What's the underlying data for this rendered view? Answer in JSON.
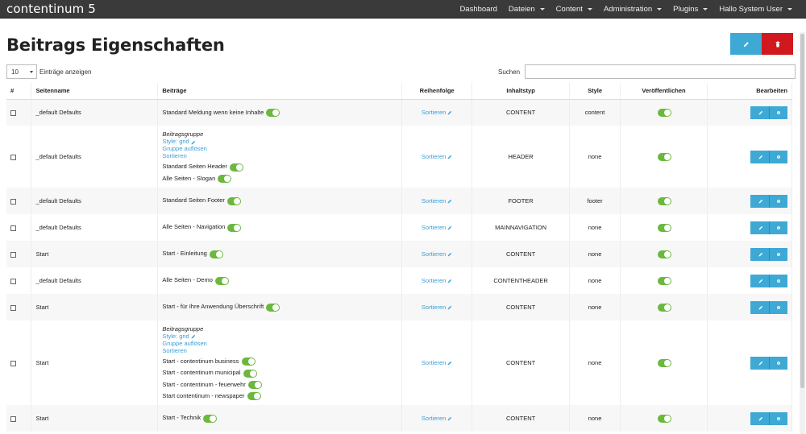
{
  "app": {
    "brand": "contentinum 5"
  },
  "nav": [
    {
      "label": "Dashboard",
      "caret": false
    },
    {
      "label": "Dateien",
      "caret": true
    },
    {
      "label": "Content",
      "caret": true
    },
    {
      "label": "Administration",
      "caret": true
    },
    {
      "label": "Plugins",
      "caret": true
    },
    {
      "label": "Hallo System User",
      "caret": true
    }
  ],
  "page": {
    "title": "Beitrags Eigenschaften"
  },
  "controls": {
    "length_value": "10",
    "length_label": "Einträge anzeigen",
    "search_label": "Suchen",
    "search_value": ""
  },
  "colors": {
    "accent": "#3ea9d5",
    "danger": "#d0181e",
    "toggle": "#6bb83e",
    "link": "#3a9ed4"
  },
  "table": {
    "headers": [
      "#",
      "Seitenname",
      "Beiträge",
      "Reihenfolge",
      "Inhaltstyp",
      "Style",
      "Veröffentlichen",
      "Bearbeiten"
    ],
    "rows": [
      {
        "name": "_default Defaults",
        "group": null,
        "items": [
          "Standard Meldung wenn keine Inhalte"
        ],
        "order": "Sortieren",
        "type": "CONTENT",
        "style": "content",
        "published": true
      },
      {
        "name": "_default Defaults",
        "group": {
          "title": "Beitragsgruppe",
          "style": "Style: grid",
          "dissolve": "Gruppe auflösen",
          "sort": "Sortieren"
        },
        "items": [
          "Standard Seiten Header",
          "Alle Seiten - Slogan"
        ],
        "order": "Sortieren",
        "type": "HEADER",
        "style": "none",
        "published": true
      },
      {
        "name": "_default Defaults",
        "group": null,
        "items": [
          "Standard Seiten Footer"
        ],
        "order": "Sortieren",
        "type": "FOOTER",
        "style": "footer",
        "published": true
      },
      {
        "name": "_default Defaults",
        "group": null,
        "items": [
          "Alle Seiten - Navigation"
        ],
        "order": "Sortieren",
        "type": "MAINNAVIGATION",
        "style": "none",
        "published": true
      },
      {
        "name": "Start",
        "group": null,
        "items": [
          "Start - Einleitung"
        ],
        "order": "Sortieren",
        "type": "CONTENT",
        "style": "none",
        "published": true
      },
      {
        "name": "_default Defaults",
        "group": null,
        "items": [
          "Alle Seiten - Demo"
        ],
        "order": "Sortieren",
        "type": "CONTENTHEADER",
        "style": "none",
        "published": true
      },
      {
        "name": "Start",
        "group": null,
        "items": [
          "Start - für Ihre Anwendung Überschrift"
        ],
        "order": "Sortieren",
        "type": "CONTENT",
        "style": "none",
        "published": true
      },
      {
        "name": "Start",
        "group": {
          "title": "Beitragsgruppe",
          "style": "Style: grid",
          "dissolve": "Gruppe auflösen",
          "sort": "Sortieren"
        },
        "items": [
          "Start - contentinum business",
          "Start - contentinum municipal",
          "Start - contentinum - feuerwehr",
          "Start contentinum - newspaper"
        ],
        "order": "Sortieren",
        "type": "CONTENT",
        "style": "none",
        "published": true
      },
      {
        "name": "Start",
        "group": null,
        "items": [
          "Start - Technik"
        ],
        "order": "Sortieren",
        "type": "CONTENT",
        "style": "none",
        "published": true
      }
    ]
  }
}
